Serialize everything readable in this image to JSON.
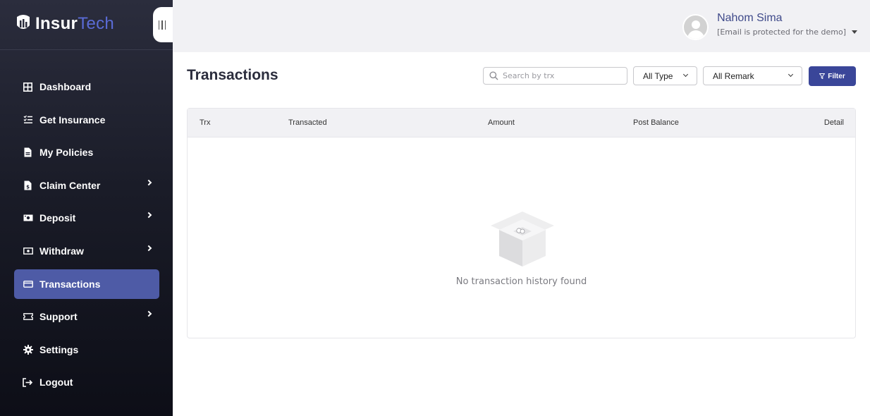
{
  "brand": {
    "part1": "Insur",
    "part2": "Tech"
  },
  "sidebar": {
    "items": [
      {
        "label": "Dashboard",
        "icon": "grid-icon"
      },
      {
        "label": "Get Insurance",
        "icon": "list-check-icon"
      },
      {
        "label": "My Policies",
        "icon": "document-icon"
      },
      {
        "label": "Claim Center",
        "icon": "invoice-icon"
      },
      {
        "label": "Deposit",
        "icon": "cash-icon"
      },
      {
        "label": "Withdraw",
        "icon": "money-icon"
      },
      {
        "label": "Transactions",
        "icon": "card-icon"
      },
      {
        "label": "Support",
        "icon": "ticket-icon"
      },
      {
        "label": "Settings",
        "icon": "gear-icon"
      },
      {
        "label": "Logout",
        "icon": "logout-icon"
      }
    ],
    "active": "Transactions"
  },
  "header": {
    "user_name": "Nahom Sima",
    "user_email": "[Email is protected for the demo]"
  },
  "main": {
    "title": "Transactions",
    "search_placeholder": "Search by trx",
    "type_select": "All Type",
    "remark_select": "All Remark",
    "filter_label": "Filter",
    "columns": [
      "Trx",
      "Transacted",
      "Amount",
      "Post Balance",
      "Detail"
    ],
    "empty_message": "No transaction history found"
  },
  "colors": {
    "accent": "#3a4699",
    "active_nav": "#4e5ba6",
    "brand_secondary": "#5a6bd6"
  }
}
